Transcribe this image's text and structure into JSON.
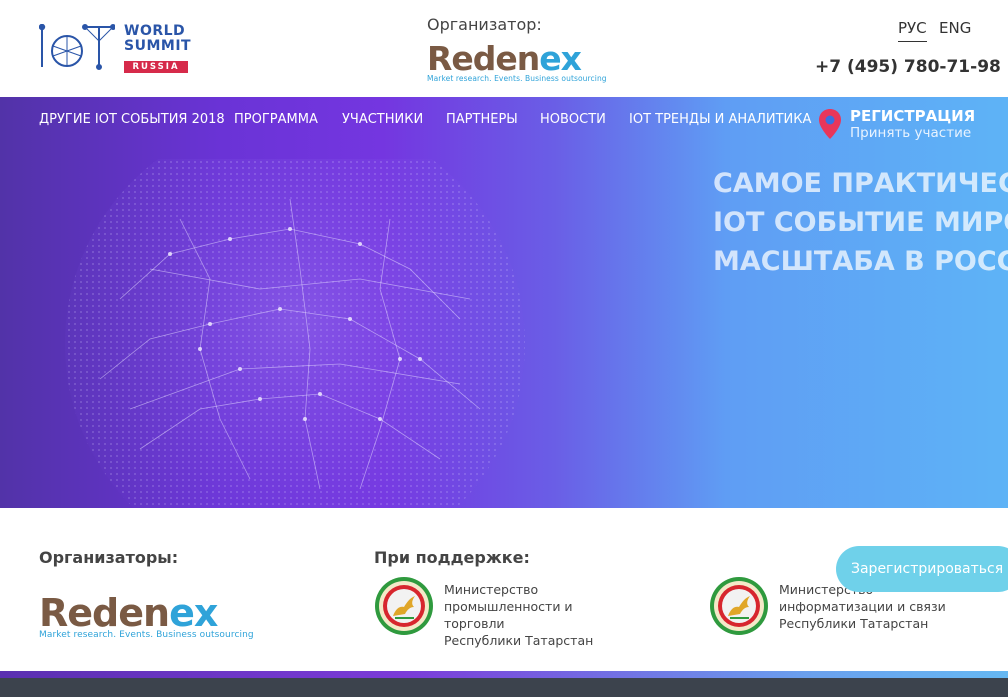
{
  "header": {
    "logo": {
      "line1": "WORLD",
      "line2": "SUMMIT",
      "badge": "RUSSIA"
    },
    "organizer_label": "Организатор:",
    "organizer_logo": {
      "name_part1": "Reden",
      "name_part2": "ex",
      "tagline": "Market research. Events. Business outsourcing"
    },
    "languages": [
      "РУС",
      "ENG"
    ],
    "phone": "+7 (495) 780-71-98"
  },
  "nav": {
    "items": [
      "ДРУГИЕ IOT СОБЫТИЯ 2018",
      "ПРОГРАММА",
      "УЧАСТНИКИ",
      "ПАРТНЕРЫ",
      "НОВОСТИ",
      "IOT ТРЕНДЫ И АНАЛИТИКА"
    ],
    "registration": {
      "title": "РЕГИСТРАЦИЯ",
      "subtitle": "Принять участие"
    }
  },
  "hero": {
    "headline_lines": [
      "САМОЕ ПРАКТИЧЕС",
      "IOT СОБЫТИЕ МИРО",
      "МАСШТАБА В РОСС"
    ]
  },
  "support": {
    "organizers_title": "Организаторы:",
    "organizer_logo": {
      "name_part1": "Reden",
      "name_part2": "ex",
      "tagline": "Market research. Events. Business outsourcing"
    },
    "support_title": "При поддержке:",
    "ministries": [
      {
        "line1": "Министерство",
        "line2": "промышленности и торговли",
        "line3": "Республики Татарстан"
      },
      {
        "line1": "Министерство",
        "line2": "информатизации и связи",
        "line3": "Республики Татарстан"
      }
    ]
  },
  "cta": {
    "label": "Зарегистрироваться"
  },
  "colors": {
    "brand_blue": "#2a55a8",
    "brand_red": "#d62a4a",
    "redenex_brown": "#7a5a44",
    "redenex_blue": "#2fa3d9",
    "hero_purple": "#7436e0",
    "hero_blue": "#5eb3f6",
    "cta": "#6fd1ea",
    "footer": "#3c434d"
  },
  "icons": [
    "iot-logo-icon",
    "location-pin-icon",
    "globe-network-illustration",
    "tatarstan-emblem-icon"
  ]
}
